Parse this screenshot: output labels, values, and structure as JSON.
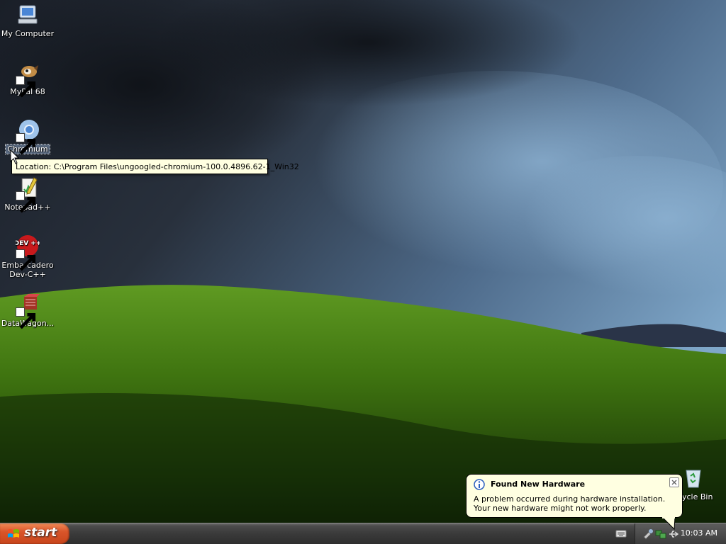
{
  "desktop": {
    "icons": [
      {
        "label": "My Computer",
        "icon": "computer-icon"
      },
      {
        "label": "MyPal 68",
        "icon": "mypal-icon"
      },
      {
        "label": "Chromium",
        "icon": "chromium-icon"
      },
      {
        "label": "Notepad++",
        "icon": "notepadpp-icon"
      },
      {
        "label": "Embarcadero Dev-C++",
        "icon": "devcpp-icon"
      },
      {
        "label": "DataWagon...",
        "icon": "datawagon-icon"
      },
      {
        "label": "ycle Bin",
        "icon": "recycle-bin-icon"
      }
    ],
    "devcpp_logo_text": "DEV ++"
  },
  "tooltip": {
    "text": "Location: C:\\Program Files\\ungoogled-chromium-100.0.4896.62-1_Win32"
  },
  "balloon": {
    "title": "Found New Hardware",
    "body": "A problem occurred during hardware installation. Your new hardware might not work properly."
  },
  "taskbar": {
    "start_label": "start",
    "clock": "10:03 AM"
  },
  "colors": {
    "tooltip_bg": "#ffffe1",
    "start_button": "#d9552a",
    "taskbar": "#3a3a3a"
  }
}
